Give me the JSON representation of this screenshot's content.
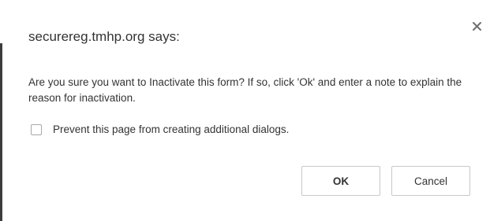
{
  "dialog": {
    "title": "securereg.tmhp.org says:",
    "close_icon": "close-icon",
    "message": "Are you sure you want to Inactivate this form?  If so, click 'Ok' and enter a note to explain the reason for inactivation.",
    "suppress_label": "Prevent this page from creating additional dialogs.",
    "suppress_checked": false,
    "ok_label": "OK",
    "cancel_label": "Cancel"
  },
  "colors": {
    "text": "#333333",
    "button_border": "#c8c8c8",
    "close_icon": "#707070",
    "background": "#ffffff"
  }
}
